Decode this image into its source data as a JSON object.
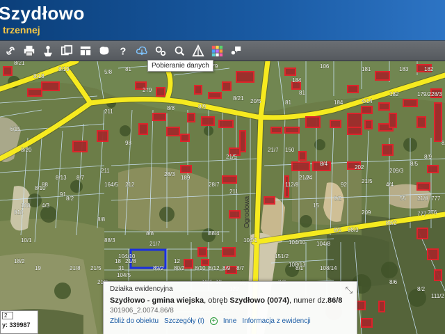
{
  "header": {
    "title": "Szydłowo",
    "subtitle": "trzennej"
  },
  "toolbar": {
    "tools": [
      "link-icon",
      "print-icon",
      "pin-icon",
      "copy-icon",
      "layout-icon",
      "map-shape-icon",
      "help-icon",
      "cloud-download-icon",
      "settings-icon",
      "zoom-icon",
      "triangle-icon",
      "color-grid-icon",
      "comment-icon"
    ],
    "tooltip": "Pobieranie danych"
  },
  "map": {
    "parcel_labels": [
      "8/18",
      "8/19",
      "8/21",
      "5/8",
      "81",
      "279",
      "2/4",
      "279",
      "184",
      "106",
      "181",
      "183",
      "182",
      "19",
      "6/15",
      "8/20",
      "88",
      "91",
      "211",
      "98",
      "211",
      "8/8",
      "8/9",
      "8/21",
      "20/5",
      "81",
      "81",
      "184",
      "4/14",
      "182",
      "179/2",
      "28/3",
      "164/5",
      "212",
      "189",
      "28/3",
      "28/7",
      "211",
      "21/5",
      "21/7",
      "150",
      "92",
      "21/5",
      "209/3",
      "8/5",
      "8/9",
      "8/13",
      "108",
      "818",
      "4/3",
      "8/2",
      "8/13",
      "8/7",
      "8/10",
      "8/8",
      "8/8",
      "104/10",
      "104/5",
      "88/4",
      "104/1",
      "104/10",
      "104/8",
      "151/2",
      "108/13",
      "108/14",
      "8/3",
      "8/1",
      "12",
      "18",
      "10/6",
      "122",
      "24",
      "21/2",
      "112/8",
      "15",
      "24",
      "8/4",
      "8/2",
      "202",
      "209",
      "4/4",
      "55",
      "21/8",
      "777",
      "776",
      "777",
      "88/2",
      "88/3",
      "21/7",
      "21/8",
      "18",
      "31",
      "10/1",
      "18/2",
      "19",
      "21/8",
      "21/5",
      "21/5",
      "89/2",
      "80/2",
      "8/10",
      "8/12",
      "8/9",
      "8/7",
      "8/6",
      "8/2",
      "111/2",
      "8/5",
      "88/3"
    ],
    "road_label": "Ogrodowa"
  },
  "popup": {
    "header": "Działka ewidencyjna",
    "name": "Szydłowo - gmina wiejska",
    "obreb_text": ", obręb ",
    "obreb": "Szydłowo (0074)",
    "numer_text": ", numer dz.",
    "numer": "86/8",
    "id": "301906_2.0074.86/8",
    "links": {
      "zoom": "Zbliż do obiektu",
      "details": "Szczegóły (I)",
      "other": "Inne",
      "info": "Informacja z ewidencji"
    }
  },
  "coords": {
    "zoom_value": "2",
    "y_label": "y:",
    "y_value": "339987"
  }
}
